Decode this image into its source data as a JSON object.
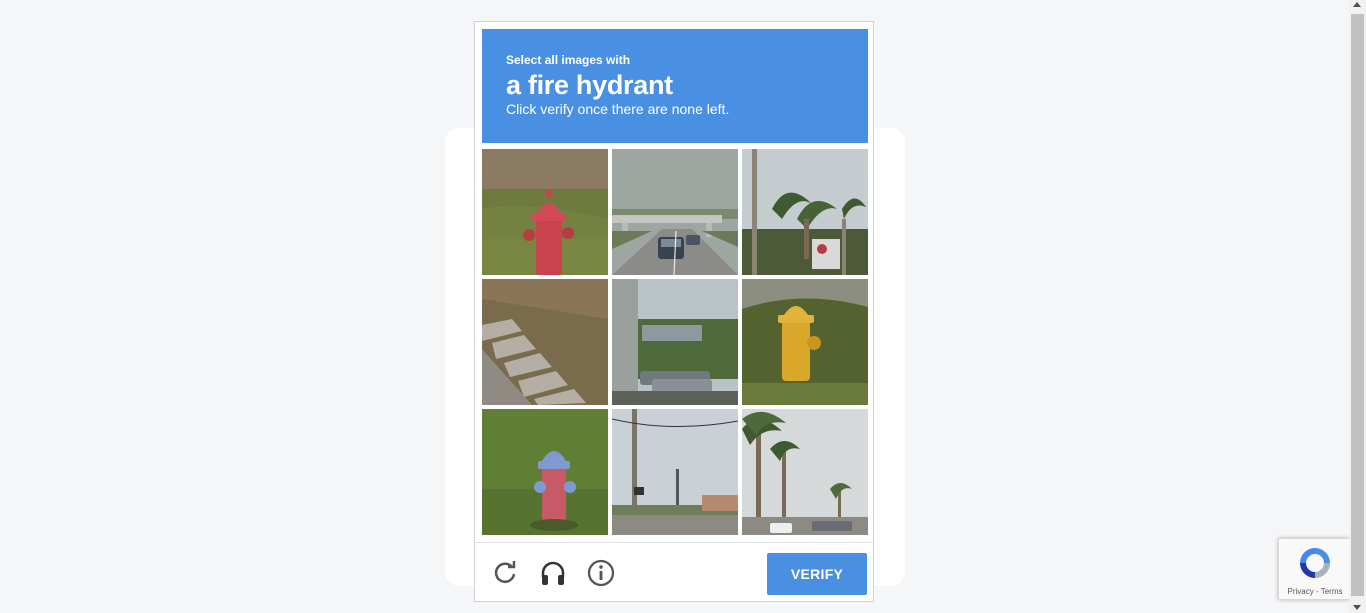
{
  "challenge": {
    "instruction_prefix": "Select all images with",
    "target": "a fire hydrant",
    "instruction_suffix": "Click verify once there are none left.",
    "header_color": "#4a90e2"
  },
  "tiles": [
    {
      "depicts": "red fire hydrant on grass"
    },
    {
      "depicts": "highway with cars and overpass"
    },
    {
      "depicts": "palm trees and roadside sign"
    },
    {
      "depicts": "stone curb steps"
    },
    {
      "depicts": "utility pole and parked cars"
    },
    {
      "depicts": "yellow fire hydrant"
    },
    {
      "depicts": "red and blue fire hydrant"
    },
    {
      "depicts": "street with utility poles"
    },
    {
      "depicts": "palm tree lined street"
    }
  ],
  "footer": {
    "reload_icon": "reload-icon",
    "audio_icon": "headphones-icon",
    "info_icon": "info-icon",
    "verify_label": "VERIFY"
  },
  "recaptcha_badge": {
    "privacy_label": "Privacy",
    "separator": " - ",
    "terms_label": "Terms"
  }
}
